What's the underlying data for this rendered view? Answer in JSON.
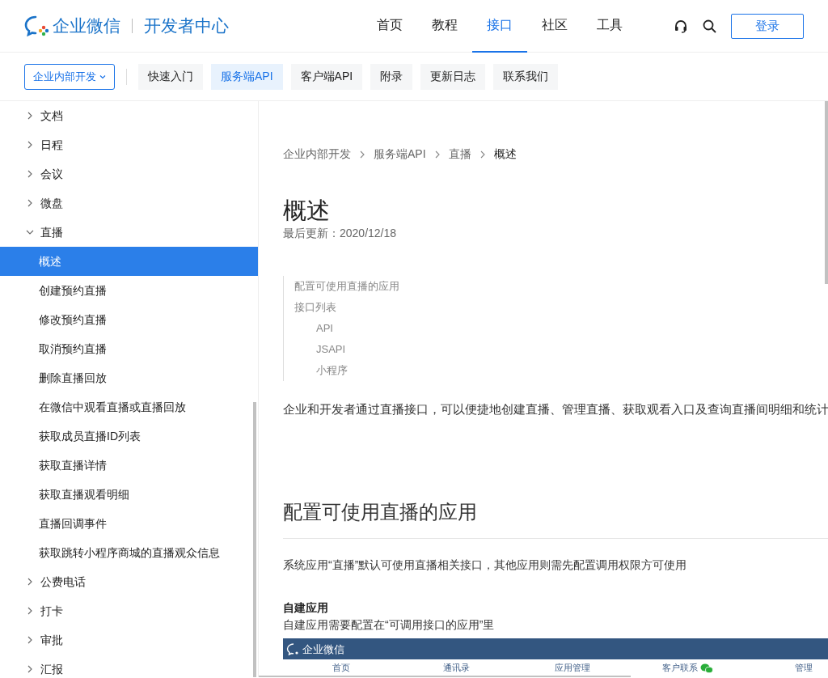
{
  "brand": {
    "name": "企业微信",
    "section": "开发者中心"
  },
  "nav": [
    {
      "label": "首页",
      "selected": false
    },
    {
      "label": "教程",
      "selected": false
    },
    {
      "label": "接口",
      "selected": true
    },
    {
      "label": "社区",
      "selected": false
    },
    {
      "label": "工具",
      "selected": false
    }
  ],
  "login_button": "登录",
  "subnav": {
    "dropdown": "企业内部开发",
    "tabs": [
      {
        "label": "快速入门",
        "selected": false
      },
      {
        "label": "服务端API",
        "selected": true
      },
      {
        "label": "客户端API",
        "selected": false
      },
      {
        "label": "附录",
        "selected": false
      },
      {
        "label": "更新日志",
        "selected": false
      },
      {
        "label": "联系我们",
        "selected": false
      }
    ]
  },
  "sidebar": {
    "items": [
      {
        "label": "文档",
        "expanded": false
      },
      {
        "label": "日程",
        "expanded": false
      },
      {
        "label": "会议",
        "expanded": false
      },
      {
        "label": "微盘",
        "expanded": false
      },
      {
        "label": "直播",
        "expanded": true,
        "children": [
          {
            "label": "概述",
            "selected": true
          },
          {
            "label": "创建预约直播",
            "selected": false
          },
          {
            "label": "修改预约直播",
            "selected": false
          },
          {
            "label": "取消预约直播",
            "selected": false
          },
          {
            "label": "删除直播回放",
            "selected": false
          },
          {
            "label": "在微信中观看直播或直播回放",
            "selected": false
          },
          {
            "label": "获取成员直播ID列表",
            "selected": false
          },
          {
            "label": "获取直播详情",
            "selected": false
          },
          {
            "label": "获取直播观看明细",
            "selected": false
          },
          {
            "label": "直播回调事件",
            "selected": false
          },
          {
            "label": "获取跳转小程序商城的直播观众信息",
            "selected": false
          }
        ]
      },
      {
        "label": "公费电话",
        "expanded": false
      },
      {
        "label": "打卡",
        "expanded": false
      },
      {
        "label": "审批",
        "expanded": false
      },
      {
        "label": "汇报",
        "expanded": false
      }
    ]
  },
  "breadcrumb": [
    "企业内部开发",
    "服务端API",
    "直播",
    "概述"
  ],
  "title": "概述",
  "updated": "最后更新：2020/12/18",
  "toc": [
    {
      "label": "配置可使用直播的应用"
    },
    {
      "label": "接口列表",
      "children": [
        {
          "label": "API"
        },
        {
          "label": "JSAPI"
        },
        {
          "label": "小程序"
        }
      ]
    }
  ],
  "intro": "企业和开发者通过直播接口，可以便捷地创建直播、管理直播、获取观看入口及查询直播间明细和统计",
  "section_heading": "配置可使用直播的应用",
  "section_text": "系统应用“直播”默认可使用直播相关接口，其他应用则需先配置调用权限方可使用",
  "subheading": "自建应用",
  "subheading_text": "自建应用需要配置在“可调用接口的应用”里",
  "embedded_screenshot": {
    "brand": "企业微信",
    "nav": [
      {
        "label": "首页",
        "kind": "text"
      },
      {
        "label": "通讯录",
        "kind": "text"
      },
      {
        "label": "应用管理",
        "kind": "text"
      },
      {
        "label": "客户联系",
        "kind": "wechat"
      },
      {
        "label": "管理",
        "kind": "text"
      }
    ]
  }
}
